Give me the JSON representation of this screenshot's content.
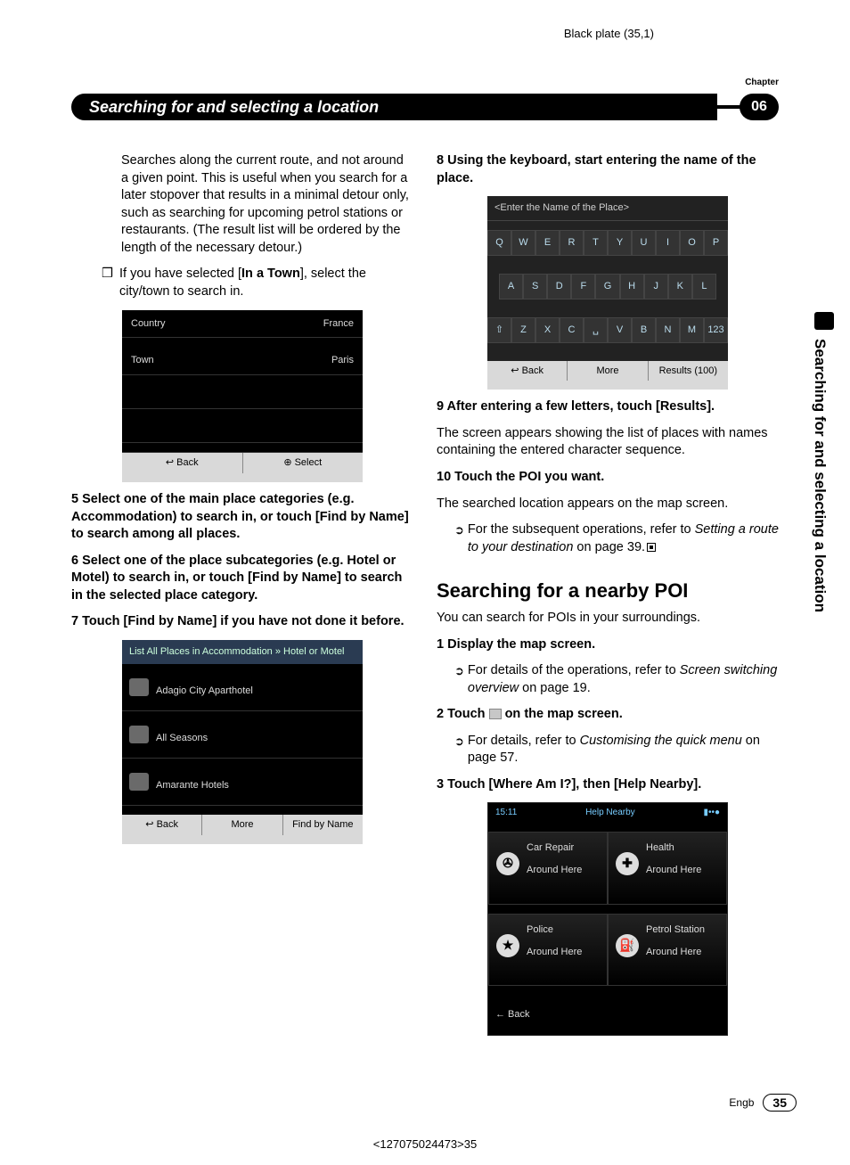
{
  "meta": {
    "plate": "Black plate (35,1)",
    "chapter_label": "Chapter",
    "chapter_number": "06",
    "chapter_title": "Searching for and selecting a location",
    "side_tab": "Searching for and selecting a location",
    "footer_lang": "Engb",
    "footer_page": "35",
    "doc_code": "<127075024473>35"
  },
  "left": {
    "intro": "Searches along the current route, and not around a given point. This is useful when you search for a later stopover that results in a minimal detour only, such as searching for upcoming petrol stations or restaurants. (The result list will be ordered by the length of the necessary detour.)",
    "bullet_if_town_pre": "If you have selected [",
    "bullet_if_town_bold": "In a Town",
    "bullet_if_town_post": "], select the city/town to search in.",
    "shot_town": {
      "row1_label": "Country",
      "row1_value": "France",
      "row2_label": "Town",
      "row2_value": "Paris",
      "back": "↩ Back",
      "select": "⊕ Select"
    },
    "step5": "5   Select one of the main place categories (e.g. Accommodation) to search in, or touch [Find by Name] to search among all places.",
    "step6": "6   Select one of the place subcategories (e.g. Hotel or Motel) to search in, or touch [Find by Name] to search in the selected place category.",
    "step7": "7   Touch [Find by Name] if you have not done it before.",
    "shot_list": {
      "header": "List All Places in Accommodation » Hotel or Motel",
      "item1": "Adagio City Aparthotel",
      "item2": "All Seasons",
      "item3": "Amarante Hotels",
      "back": "↩ Back",
      "more": "More",
      "find": "Find by Name"
    }
  },
  "right": {
    "step8": "8   Using the keyboard, start entering the name of the place.",
    "kb": {
      "placeholder": "<Enter the Name of the Place>",
      "r1": [
        "Q",
        "W",
        "E",
        "R",
        "T",
        "Y",
        "U",
        "I",
        "O",
        "P"
      ],
      "r2": [
        "A",
        "S",
        "D",
        "F",
        "G",
        "H",
        "J",
        "K",
        "L"
      ],
      "r3": [
        "⇧",
        "Z",
        "X",
        "C",
        "␣",
        "V",
        "B",
        "N",
        "M",
        "123"
      ],
      "back": "↩ Back",
      "more": "More",
      "results": "Results (100)"
    },
    "step9_head": "9   After entering a few letters, touch [Results].",
    "step9_body": "The screen appears showing the list of places with names containing the entered character sequence.",
    "step10_head": "10 Touch the POI you want.",
    "step10_body": "The searched location appears on the map screen.",
    "step10_ref_pre": "For the subsequent operations, refer to ",
    "step10_ref_ital": "Setting a route to your destination",
    "step10_ref_post": " on page 39.",
    "h2": "Searching for a nearby POI",
    "h2_sub": "You can search for POIs in your surroundings.",
    "n1_head": "1   Display the map screen.",
    "n1_ref_pre": "For details of the operations, refer to ",
    "n1_ref_ital": "Screen switching overview",
    "n1_ref_post": " on page 19.",
    "n2_head_pre": "2   Touch ",
    "n2_head_post": " on the map screen.",
    "n2_ref_pre": "For details, refer to ",
    "n2_ref_ital": "Customising the quick menu",
    "n2_ref_post": " on page 57.",
    "n3_head": "3   Touch [Where Am I?], then [Help Nearby].",
    "help": {
      "time": "15:11",
      "title": "Help Nearby",
      "c1a": "Car Repair",
      "c1b": "Around Here",
      "c2a": "Health",
      "c2b": "Around Here",
      "c3a": "Police",
      "c3b": "Around Here",
      "c4a": "Petrol Station",
      "c4b": "Around Here",
      "back": "← Back"
    }
  }
}
